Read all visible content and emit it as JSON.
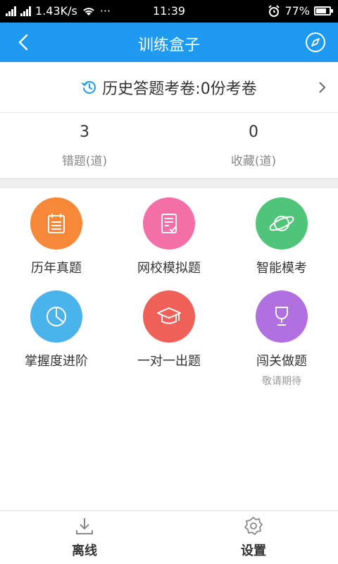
{
  "status_bar": {
    "network_speed": "1.43K/s",
    "more": "···",
    "time": "11:39",
    "battery": "77%",
    "battery_level": 0.77
  },
  "header": {
    "title": "训练盒子",
    "back_icon": "chevron-left-icon",
    "right_icon": "compass-icon"
  },
  "history": {
    "label": "历史答题考卷:0份考卷",
    "icon": "history-clock-icon"
  },
  "stats": [
    {
      "value": "3",
      "label": "错题(道)"
    },
    {
      "value": "0",
      "label": "收藏(道)"
    }
  ],
  "tiles": [
    {
      "label": "历年真题",
      "color": "#f7883a",
      "icon": "calendar-icon"
    },
    {
      "label": "网校模拟题",
      "color": "#f46fa8",
      "icon": "document-check-icon"
    },
    {
      "label": "智能模考",
      "color": "#50c57a",
      "icon": "planet-icon"
    },
    {
      "label": "掌握度进阶",
      "color": "#4bb3ec",
      "icon": "pie-chart-icon"
    },
    {
      "label": "一对一出题",
      "color": "#ee6058",
      "icon": "graduation-cap-icon"
    },
    {
      "label": "闯关做题",
      "sub": "敬请期待",
      "color": "#b070e0",
      "icon": "trophy-icon"
    }
  ],
  "bottom_nav": [
    {
      "label": "离线",
      "icon": "download-icon"
    },
    {
      "label": "设置",
      "icon": "gear-icon"
    }
  ],
  "colors": {
    "primary": "#1e9bf0",
    "divider": "#eeeeee"
  }
}
